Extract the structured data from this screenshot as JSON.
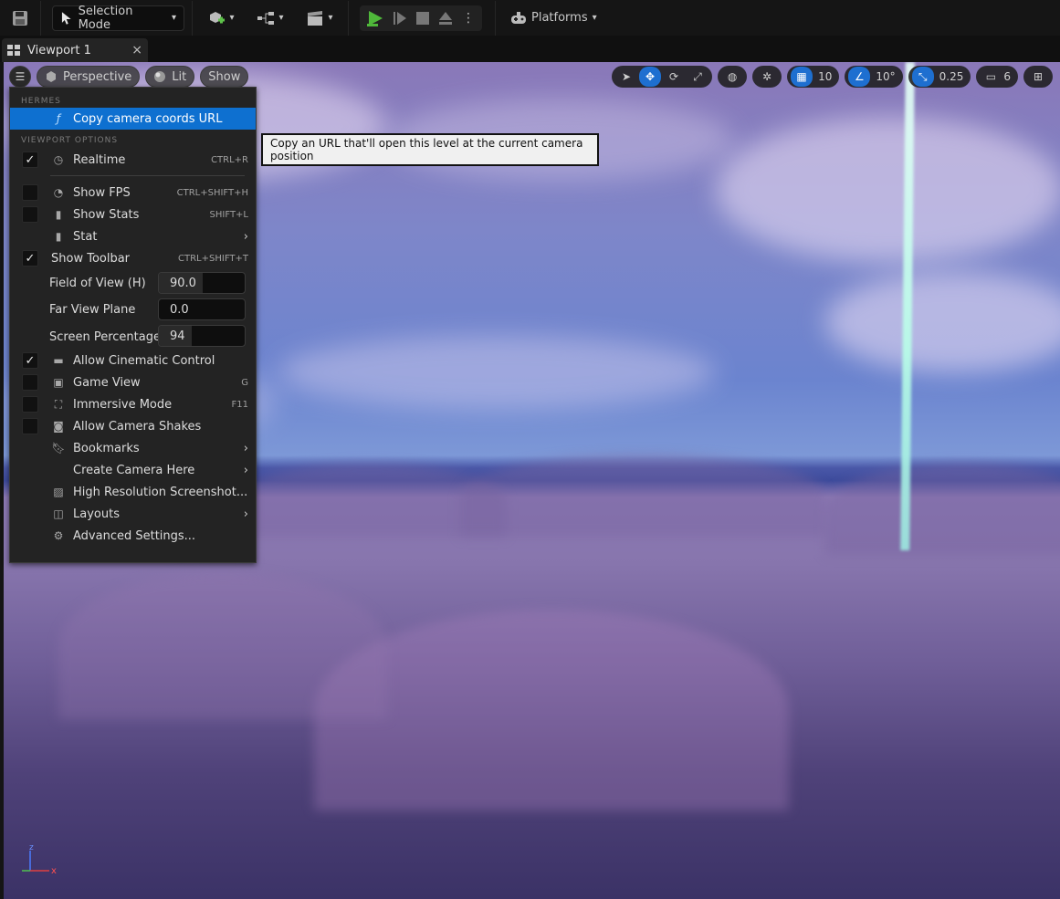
{
  "toolbar": {
    "selection_mode": "Selection Mode",
    "platforms": "Platforms"
  },
  "tab": {
    "title": "Viewport 1",
    "close": "×"
  },
  "viewport_toolbar": {
    "perspective": "Perspective",
    "lit": "Lit",
    "show": "Show",
    "grid_snap": "10",
    "rotation_snap": "10°",
    "scale_snap": "0.25",
    "camera_speed": "6"
  },
  "menu": {
    "section_hermes": "HERMES",
    "copy_camera": "Copy camera coords URL",
    "section_viewport": "VIEWPORT OPTIONS",
    "realtime": {
      "label": "Realtime",
      "shortcut": "CTRL+R",
      "checked": true
    },
    "show_fps": {
      "label": "Show FPS",
      "shortcut": "CTRL+SHIFT+H",
      "checked": false
    },
    "show_stats": {
      "label": "Show Stats",
      "shortcut": "SHIFT+L",
      "checked": false
    },
    "stat": {
      "label": "Stat"
    },
    "show_toolbar": {
      "label": "Show Toolbar",
      "shortcut": "CTRL+SHIFT+T",
      "checked": true
    },
    "fov": {
      "label": "Field of View (H)",
      "value": "90.0"
    },
    "far_view": {
      "label": "Far View Plane",
      "value": "0.0"
    },
    "screen_pct": {
      "label": "Screen Percentage",
      "value": "94"
    },
    "cinematic": {
      "label": "Allow Cinematic Control",
      "checked": true
    },
    "game_view": {
      "label": "Game View",
      "shortcut": "G",
      "checked": false
    },
    "immersive": {
      "label": "Immersive Mode",
      "shortcut": "F11",
      "checked": false
    },
    "camera_shakes": {
      "label": "Allow Camera Shakes",
      "checked": false
    },
    "bookmarks": {
      "label": "Bookmarks"
    },
    "create_camera": {
      "label": "Create Camera Here"
    },
    "hires_screenshot": {
      "label": "High Resolution Screenshot..."
    },
    "layouts": {
      "label": "Layouts"
    },
    "advanced": {
      "label": "Advanced Settings..."
    }
  },
  "tooltip": "Copy an URL that'll open this level at the current camera position",
  "axis": {
    "x": "x",
    "z": "z"
  }
}
